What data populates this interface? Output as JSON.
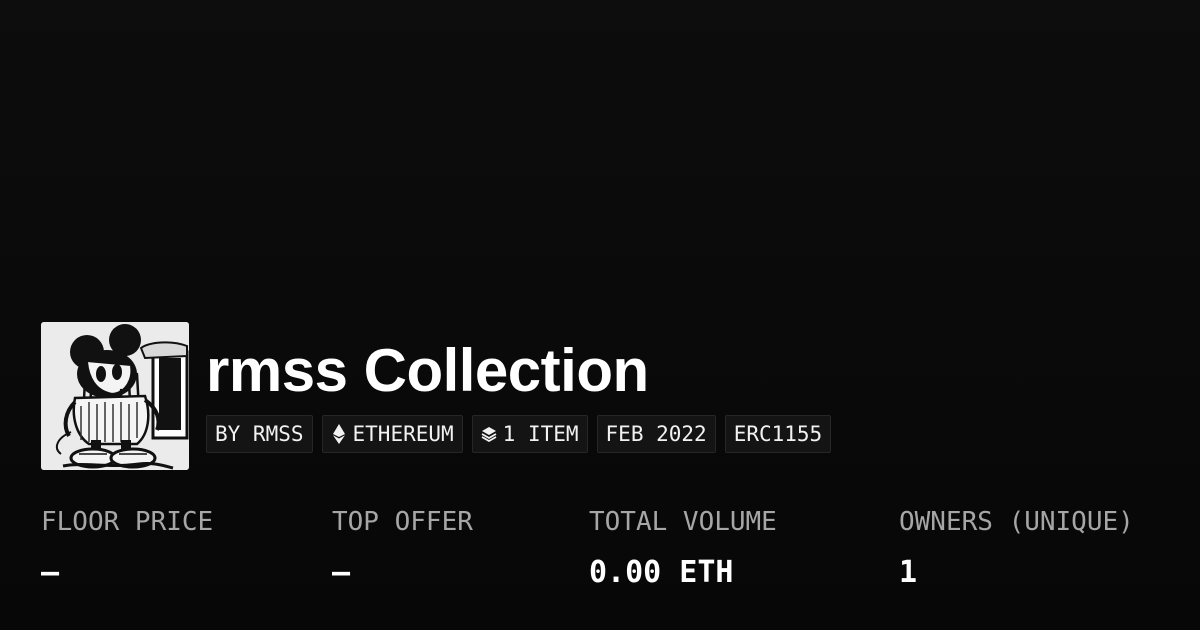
{
  "collection": {
    "title": "rmss Collection",
    "image_alt": "rmss collection thumbnail — black and white drawing of a melting cartoon mouse figure",
    "tags": [
      {
        "label": "BY RMSS",
        "icon": null
      },
      {
        "label": "ETHEREUM",
        "icon": "ethereum-icon"
      },
      {
        "label": "1 ITEM",
        "icon": "layers-icon"
      },
      {
        "label": "FEB 2022",
        "icon": null
      },
      {
        "label": "ERC1155",
        "icon": null
      }
    ]
  },
  "stats": {
    "floor_price": {
      "label": "FLOOR PRICE",
      "value": "—"
    },
    "top_offer": {
      "label": "TOP OFFER",
      "value": "—"
    },
    "total_volume": {
      "label": "TOTAL VOLUME",
      "value": "0.00 ETH"
    },
    "owners": {
      "label": "OWNERS (UNIQUE)",
      "value": "1"
    }
  },
  "colors": {
    "background": "#0a0a0a",
    "tag_background": "#141414",
    "label_gray": "#a6a6a6",
    "text": "#ffffff"
  }
}
